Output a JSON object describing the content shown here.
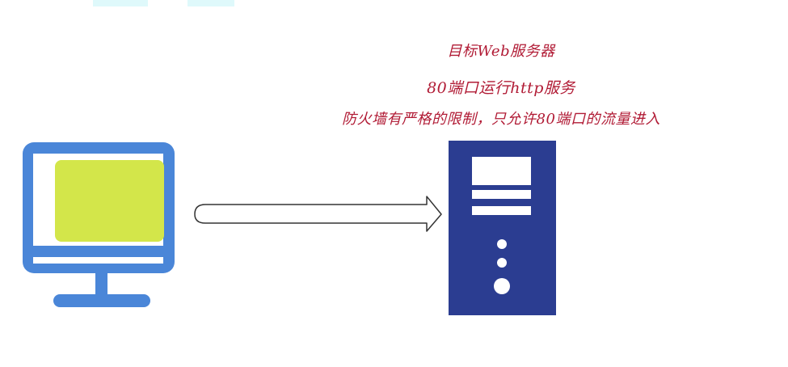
{
  "labels": {
    "server_title": "目标Web服务器",
    "service_note": "80端口运行http服务",
    "firewall_note": "防火墙有严格的限制，只允许80端口的流量进入"
  },
  "colors": {
    "annotation": "#b11b35",
    "monitor_frame": "#4a86d8",
    "monitor_screen": "#d3e64a",
    "server_body": "#2b3d91",
    "server_detail": "#ffffff",
    "arrow_stroke": "#333333",
    "top_fragment": "#dff9fb"
  },
  "icons": {
    "client": "monitor-icon",
    "target": "server-icon",
    "flow": "right-arrow-icon"
  }
}
